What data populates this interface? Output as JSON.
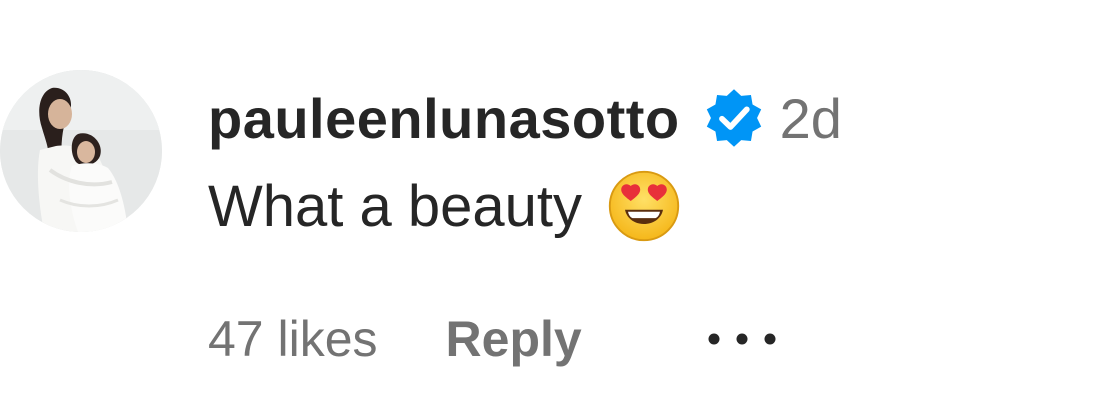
{
  "comment": {
    "username": "pauleenlunasotto",
    "verified_icon": "verified-badge-icon",
    "time_ago": "2d",
    "text": "What a beauty",
    "emoji_icon": "heart-eyes-emoji-icon",
    "likes": "47 likes",
    "reply_label": "Reply",
    "more_icon": "more-options-icon"
  },
  "colors": {
    "primary_text": "#262626",
    "secondary_text": "#737373",
    "verified_blue": "#0095f6"
  }
}
